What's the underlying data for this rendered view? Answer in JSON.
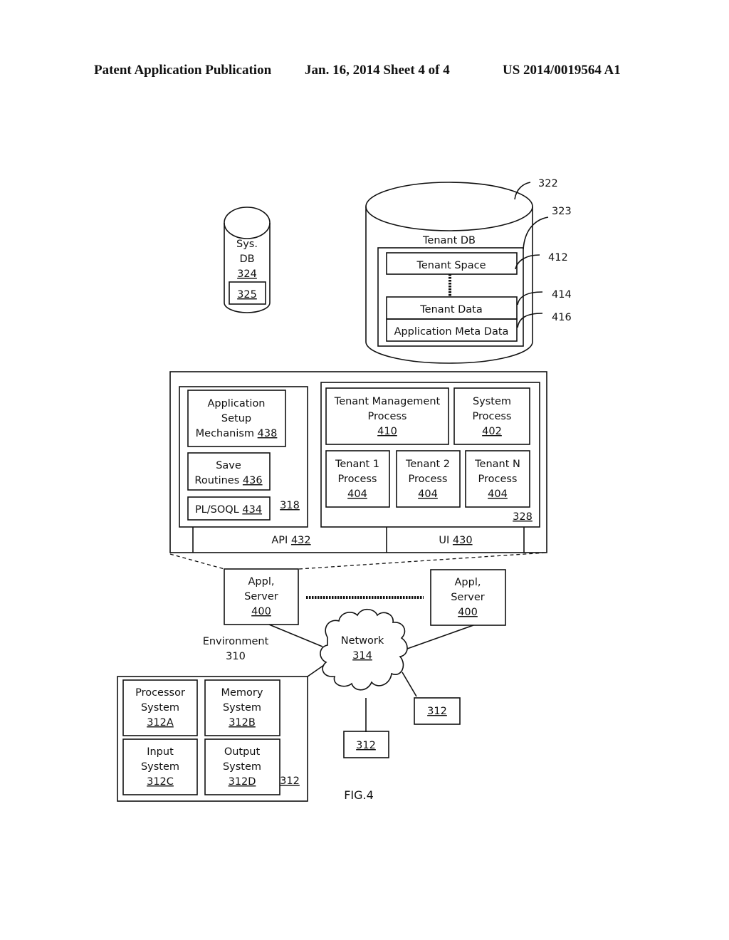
{
  "header": {
    "left": "Patent Application Publication",
    "middle": "Jan. 16, 2014  Sheet 4 of 4",
    "right": "US 2014/0019564 A1"
  },
  "sys_db": {
    "line1": "Sys.",
    "line2": "DB",
    "ref": "324",
    "inner_ref": "325"
  },
  "tenant_db": {
    "label": "Tenant DB",
    "ref_db": "322",
    "ref_container": "323",
    "tenant_space": {
      "label": "Tenant Space",
      "ref": "412"
    },
    "tenant_data": {
      "label": "Tenant Data",
      "ref": "414"
    },
    "app_meta": {
      "label": "Application Meta Data",
      "ref": "416"
    }
  },
  "server_detail": {
    "left_panel_ref": "318",
    "app_setup": {
      "line1": "Application",
      "line2": "Setup",
      "line3": "Mechanism ",
      "ref": "438"
    },
    "save_routines": {
      "line1": "Save",
      "line2": "Routines ",
      "ref": "436"
    },
    "plsoql": {
      "label": "PL/SOQL ",
      "ref": "434"
    },
    "right_panel_ref": "328",
    "tenant_mgmt": {
      "line1": "Tenant Management",
      "line2": "Process",
      "ref": "410"
    },
    "system_process": {
      "line1": "System",
      "line2": "Process",
      "ref": "402"
    },
    "tenant_processes": [
      {
        "line1": "Tenant 1",
        "line2": "Process",
        "ref": "404"
      },
      {
        "line1": "Tenant 2",
        "line2": "Process",
        "ref": "404"
      },
      {
        "line1": "Tenant N",
        "line2": "Process",
        "ref": "404"
      }
    ],
    "api": {
      "label": "API ",
      "ref": "432"
    },
    "ui": {
      "label": "UI ",
      "ref": "430"
    }
  },
  "app_servers": [
    {
      "line1": "Appl,",
      "line2": "Server",
      "ref": "400"
    },
    {
      "line1": "Appl,",
      "line2": "Server",
      "ref": "400"
    }
  ],
  "environment": {
    "line1": "Environment",
    "line2": "310"
  },
  "network": {
    "label": "Network",
    "ref": "314"
  },
  "user_system": {
    "ref": "312",
    "processor": {
      "line1": "Processor",
      "line2": "System",
      "ref": "312A"
    },
    "memory": {
      "line1": "Memory",
      "line2": "System",
      "ref": "312B"
    },
    "input": {
      "line1": "Input",
      "line2": "System",
      "ref": "312C"
    },
    "output": {
      "line1": "Output",
      "line2": "System",
      "ref": "312D"
    }
  },
  "user_systems_small": [
    {
      "ref": "312"
    },
    {
      "ref": "312"
    }
  ],
  "figure_label": "FIG.4"
}
